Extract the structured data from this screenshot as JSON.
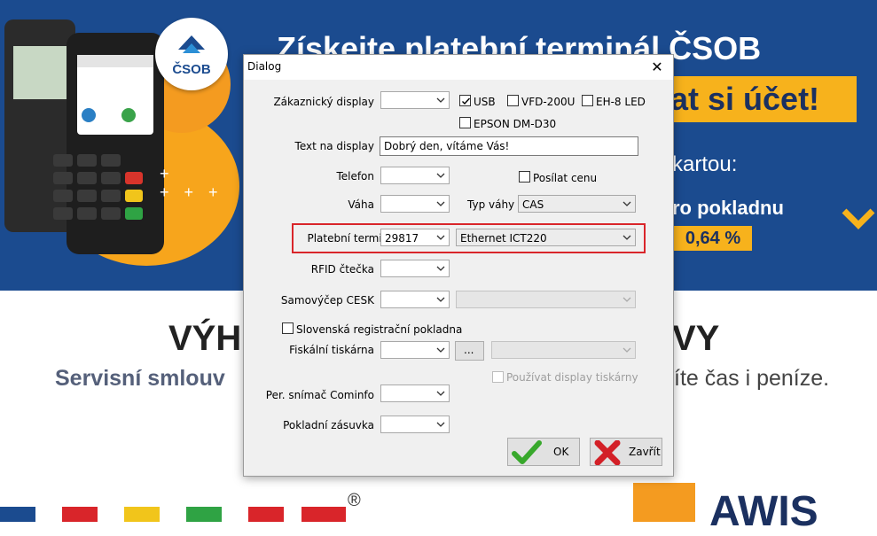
{
  "background": {
    "banner_title": "Získejte platební terminál ČSOB",
    "banner_line2": "at si účet!",
    "banner_line3": "kartou:",
    "banner_line4": "ro pokladnu",
    "banner_rate": "0,64 %",
    "logo_text": "ČSOB",
    "heading_left": "VÝH",
    "heading_right": "VY",
    "sub_left": "Servisní smlouv",
    "sub_right": "íte čas i peníze.",
    "registered_mark": "®",
    "footer_brand_right": "AWIS",
    "colors": {
      "banner": "#1b4b8f",
      "accent": "#f7b21c"
    }
  },
  "dialog": {
    "title": "Dialog",
    "close_symbol": "✕",
    "customer_display": {
      "label": "Zákaznický display",
      "value": "",
      "usb_label": "USB",
      "usb_checked": true,
      "vfd_label": "VFD-200U",
      "vfd_checked": false,
      "eh8_label": "EH-8 LED",
      "eh8_checked": false,
      "epson_label": "EPSON DM-D30",
      "epson_checked": false
    },
    "display_text": {
      "label": "Text na display",
      "value": "Dobrý den, vítáme Vás!"
    },
    "phone": {
      "label": "Telefon",
      "value": "",
      "send_price_label": "Posílat cenu",
      "send_price_checked": false
    },
    "scale": {
      "label": "Váha",
      "value": "",
      "type_label": "Typ váhy",
      "type_value": "CAS"
    },
    "payment_terminal": {
      "label": "Platební terminál",
      "port_value": "29817",
      "device_value": "Ethernet ICT220",
      "highlight_color": "#d9252a"
    },
    "rfid": {
      "label": "RFID čtečka",
      "value": ""
    },
    "self_checkout": {
      "label": "Samovýčep CESK",
      "value": "",
      "second_value": ""
    },
    "slovak_register": {
      "label": "Slovenská registrační pokladna",
      "checked": false
    },
    "fiscal_printer": {
      "label": "Fiskální tiskárna",
      "value": "",
      "browse_label": "...",
      "model_value": "",
      "use_display_label": "Používat display tiskárny",
      "use_display_checked": false
    },
    "cominfo_scanner": {
      "label": "Per. snímač Cominfo",
      "value": ""
    },
    "cash_drawer": {
      "label": "Pokladní zásuvka",
      "value": ""
    },
    "ok_button": {
      "label": "OK",
      "icon": "checkmark-icon"
    },
    "close_button": {
      "label": "Zavřít",
      "icon": "red-x-icon"
    }
  }
}
